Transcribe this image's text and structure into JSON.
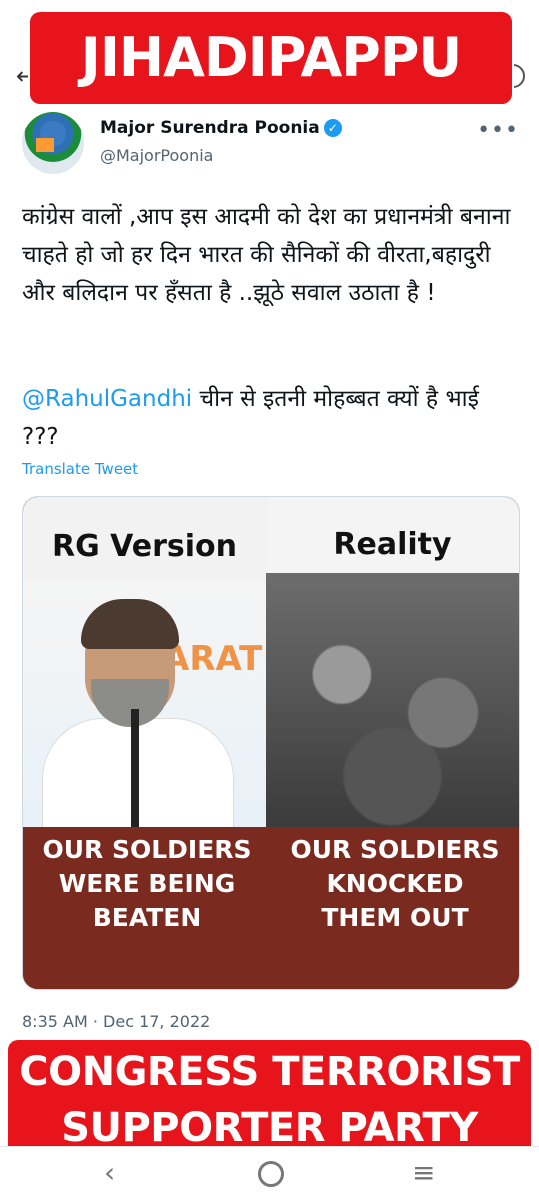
{
  "overlays": {
    "top_banner": "JIHADIPAPPU",
    "bottom_banner_line1": "CONGRESS TERRORIST",
    "bottom_banner_line2": "SUPPORTER PARTY"
  },
  "tweet": {
    "author_name": "Major Surendra Poonia",
    "handle": "@MajorPoonia",
    "verified_glyph": "✓",
    "more_glyph": "•••",
    "text_line1": "कांग्रेस वालों ,आप इस आदमी को देश का प्रधानमंत्री बनाना चाहते हो जो हर दिन भारत की सैनिकों की वीरता,बहादुरी और बलिदान पर हँसता है ..झूठे सवाल उठाता है !",
    "mention": "@RahulGandhi",
    "text_line2": " चीन से इतनी मोहब्बत क्यों है भाई ???",
    "translate_label": "Translate Tweet",
    "timestamp": "8:35 AM · Dec 17, 2022"
  },
  "media": {
    "left_heading": "RG Version",
    "right_heading": "Reality",
    "backdrop_text": "ARAT",
    "left_caption": "OUR SOLDIERS\nWERE BEING\nBEATEN",
    "right_caption": "OUR SOLDIERS\nKNOCKED\nTHEM OUT"
  },
  "navbar": {
    "back_glyph": "‹",
    "menu_glyph": "≡"
  },
  "colors": {
    "banner_red": "#e8141c",
    "link_blue": "#1d9bf0",
    "caption_bg": "#7b2a1f"
  }
}
